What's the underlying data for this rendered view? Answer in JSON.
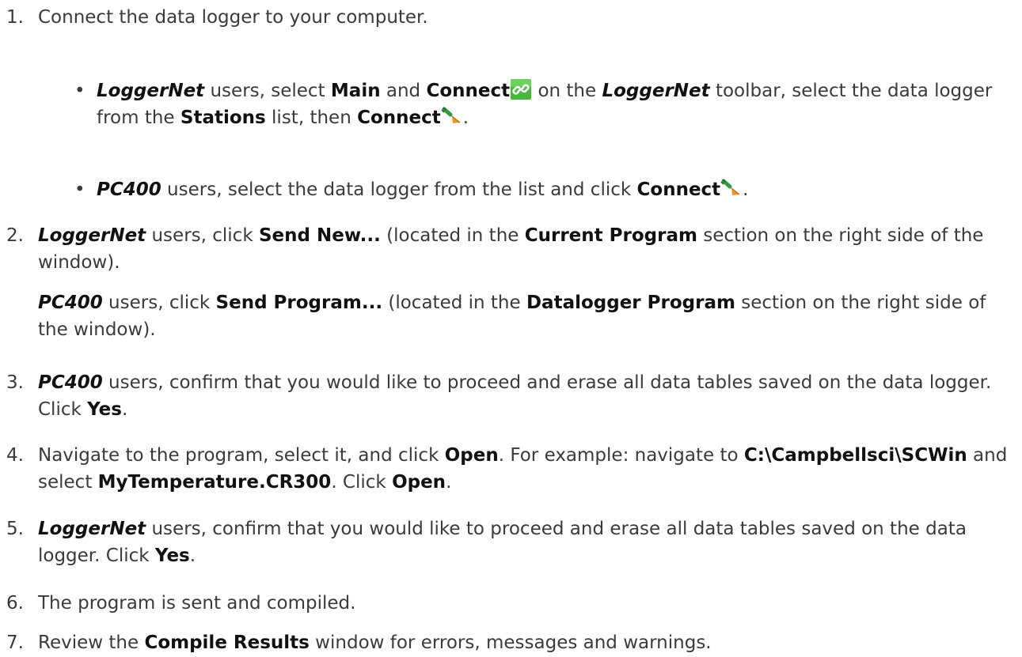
{
  "colors": {
    "text": "#3a3a3a",
    "emphasis": "#111111",
    "link_icon_bg": "#48b83c",
    "plug_green": "#2f9a3e",
    "plug_orange": "#e89a2a"
  },
  "icons": {
    "connect_toolbar": "link-icon",
    "connect_button": "plug-icon"
  },
  "steps": [
    {
      "num": "1.",
      "p1": "Connect the data logger to your computer.",
      "bullets": [
        {
          "dot": "•",
          "t1": "LoggerNet",
          "t2": " users, select ",
          "t3": "Main",
          "t4": " and ",
          "t5": "Connect",
          "t6": " on the ",
          "t7": "LoggerNet",
          "t8": " toolbar, select the data logger from the ",
          "t9": "Stations",
          "t10": " list, then ",
          "t11": "Connect",
          "t12": "."
        },
        {
          "dot": "•",
          "t1": "PC400",
          "t2": " users, select the data logger from the list and click ",
          "t3": "Connect",
          "t4": "."
        }
      ]
    },
    {
      "num": "2.",
      "a1": "LoggerNet",
      "a2": " users, click ",
      "a3": "Send New...",
      "a4": " (located in the ",
      "a5": "Current Program",
      "a6": " section on the right side of the window).",
      "b1": "PC400",
      "b2": " users, click ",
      "b3": "Send Program...",
      "b4": " (located in the ",
      "b5": "Datalogger Program",
      "b6": " section on the right side of the window)."
    },
    {
      "num": "3.",
      "a1": "PC400",
      "a2": " users, confirm that you would like to proceed and erase all data tables saved on the data logger. Click ",
      "a3": "Yes",
      "a4": "."
    },
    {
      "num": "4.",
      "a1": "Navigate to the program, select it, and click ",
      "a2": "Open",
      "a3": ". For example: navigate to ",
      "a4": "C:\\Campbellsci\\SCWin",
      "a5": " and select ",
      "a6": "MyTemperature.CR300",
      "a7": ". Click ",
      "a8": "Open",
      "a9": "."
    },
    {
      "num": "5.",
      "a1": "LoggerNet",
      "a2": " users, confirm that you would like to proceed and erase all data tables saved on the data logger. Click ",
      "a3": "Yes",
      "a4": "."
    },
    {
      "num": "6.",
      "a1": "The program is sent and compiled."
    },
    {
      "num": "7.",
      "a1": "Review the ",
      "a2": "Compile Results",
      "a3": " window for errors, messages and warnings."
    }
  ]
}
